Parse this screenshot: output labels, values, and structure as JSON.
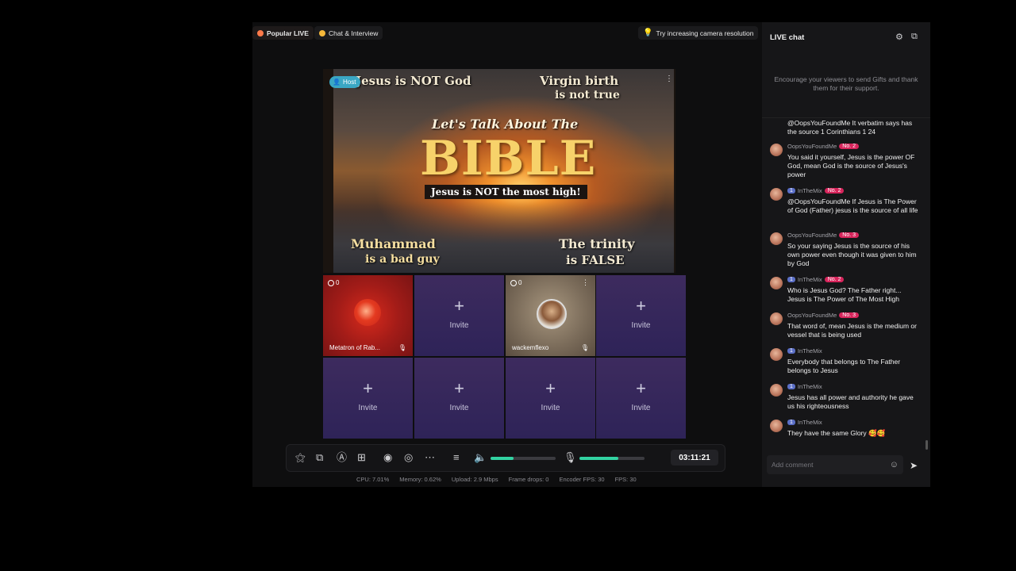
{
  "topbar": {
    "popular": "Popular LIVE",
    "chat_interview": "Chat & Interview",
    "tip": "Try increasing camera resolution"
  },
  "main_video": {
    "host_label": "Host",
    "line1": "Jesus is NOT God",
    "line2a": "Virgin birth",
    "line2b": "is not true",
    "title_small": "Let's Talk About The",
    "title_big": "BIBLE",
    "banner": "Jesus is NOT the most high!",
    "line3a": "Muhammad",
    "line3b": "is a bad guy",
    "line4a": "The trinity",
    "line4b": "is FALSE"
  },
  "guests": [
    {
      "name": "Metatron of Rab...",
      "viewers": "0"
    },
    {
      "name": "wackemflexo",
      "viewers": "0"
    }
  ],
  "invite_label": "Invite",
  "controls": {
    "timer": "03:11:21",
    "speaker_level": 0.35,
    "mic_level": 0.6
  },
  "stats": {
    "cpu": "CPU:  7.01%",
    "memory": "Memory:  0.62%",
    "upload": "Upload:  2.9 Mbps",
    "frame_drops": "Frame drops:  0",
    "encoder_fps": "Encoder FPS:  30",
    "fps": "FPS:  30"
  },
  "chat": {
    "title": "LIVE chat",
    "encourage": "Encourage your viewers to send Gifts and thank them for their support.",
    "placeholder": "Add comment",
    "messages": [
      {
        "user": "",
        "level": "",
        "badge": "",
        "text": "@OopsYouFoundMe It verbatim says has the source 1 Corinthians 1 24"
      },
      {
        "user": "OopsYouFoundMe",
        "level": "",
        "badge": "No. 2",
        "text": "You said it yourself, Jesus is the power OF God, mean God is the source of Jesus's power"
      },
      {
        "user": "InTheMix",
        "level": "1",
        "badge": "No. 2",
        "text": "@OopsYouFoundMe If Jesus is The Power of God (Father) jesus is the source of all life"
      },
      {
        "user": "OopsYouFoundMe",
        "level": "",
        "badge": "No. 3",
        "text": "So your saying Jesus is the source of his own power even though it was given to him by God"
      },
      {
        "user": "InTheMix",
        "level": "1",
        "badge": "No. 2",
        "text": "Who is Jesus God? The Father right... Jesus is The Power of The Most High"
      },
      {
        "user": "OopsYouFoundMe",
        "level": "",
        "badge": "No. 3",
        "text": "That word of, mean Jesus is the medium or vessel that is being used"
      },
      {
        "user": "InTheMix",
        "level": "1",
        "badge": "",
        "text": "Everybody that belongs to The Father belongs to Jesus"
      },
      {
        "user": "InTheMix",
        "level": "1",
        "badge": "",
        "text": "Jesus has all power and authority he gave us his righteousness"
      },
      {
        "user": "InTheMix",
        "level": "1",
        "badge": "",
        "text": "They have the same Glory 🥰🥰"
      }
    ]
  }
}
